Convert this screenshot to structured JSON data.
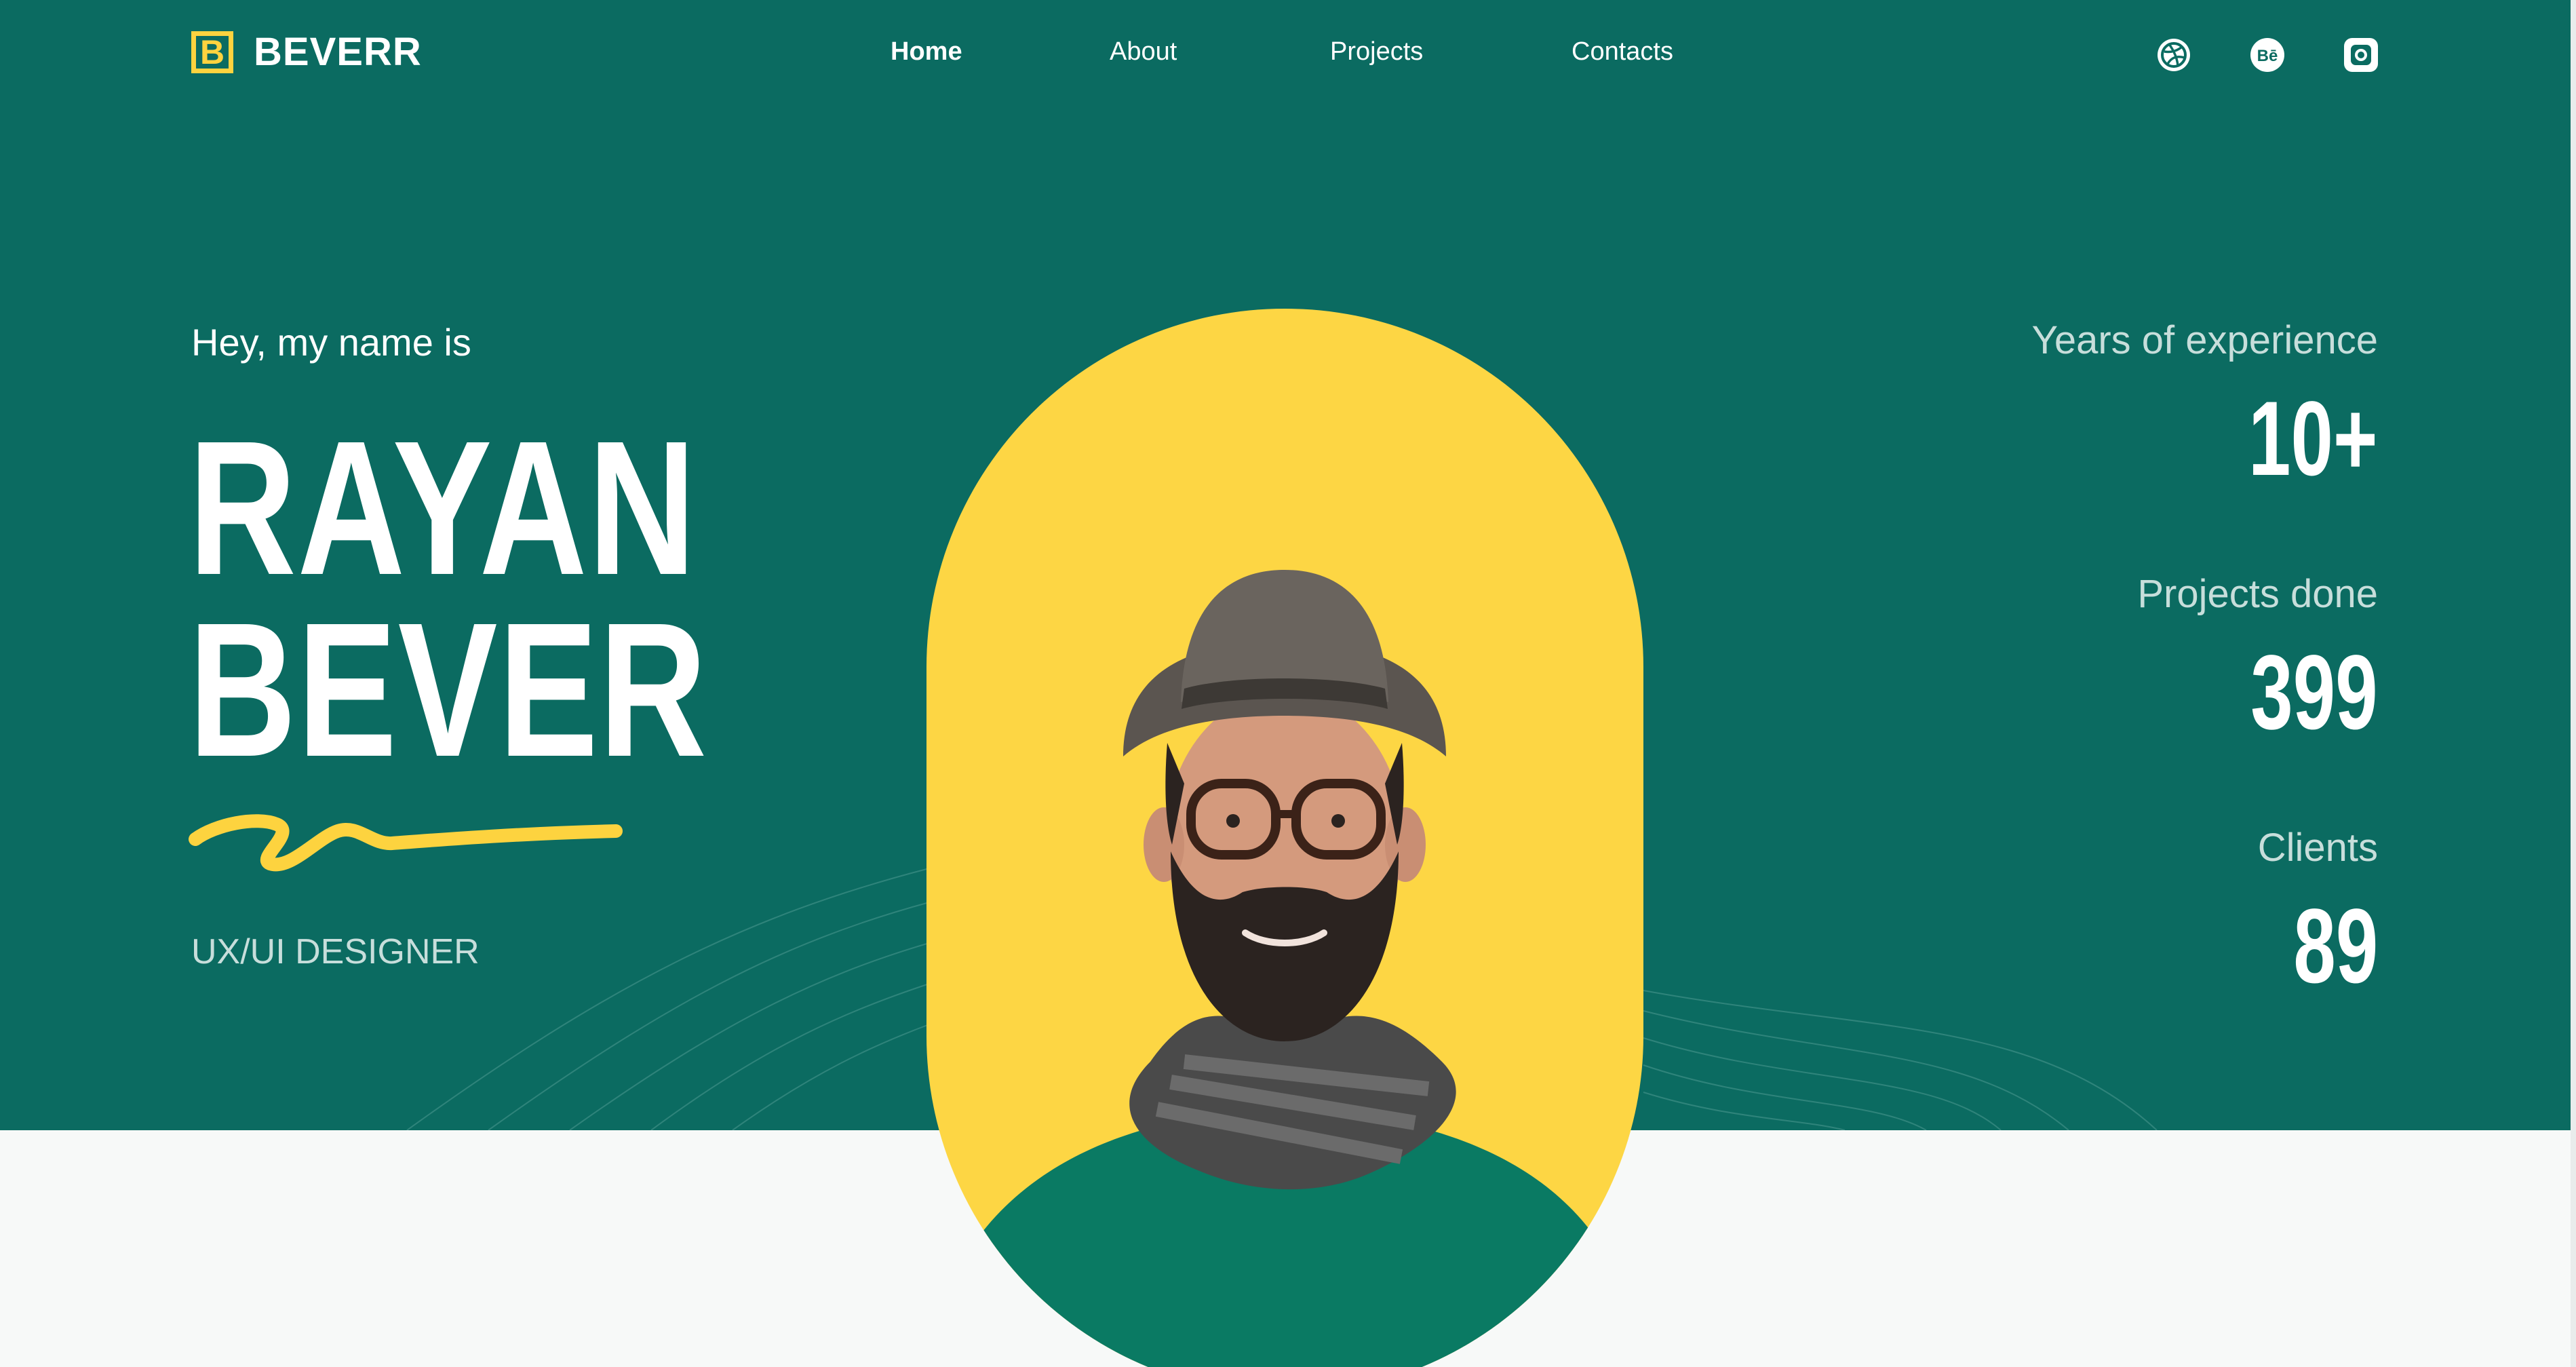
{
  "brand": {
    "logo_letter": "B",
    "name": "BEVERR"
  },
  "nav": {
    "items": [
      {
        "label": "Home"
      },
      {
        "label": "About"
      },
      {
        "label": "Projects"
      },
      {
        "label": "Contacts"
      }
    ]
  },
  "socials": [
    "dribbble-icon",
    "behance-icon",
    "instagram-icon"
  ],
  "intro": {
    "greeting": "Hey, my name is",
    "first_name": "RAYAN",
    "last_name": "BEVER",
    "role": "UX/UI DESIGNER"
  },
  "stats": [
    {
      "label": "Years of experience",
      "value": "10+"
    },
    {
      "label": "Projects done",
      "value": "399"
    },
    {
      "label": "Clients",
      "value": "89"
    }
  ],
  "colors": {
    "primary": "#0b6b61",
    "accent": "#fdd33f",
    "text_light": "#ffffff",
    "text_muted": "#c7dedb",
    "lower_bg": "#f7f9f8"
  }
}
